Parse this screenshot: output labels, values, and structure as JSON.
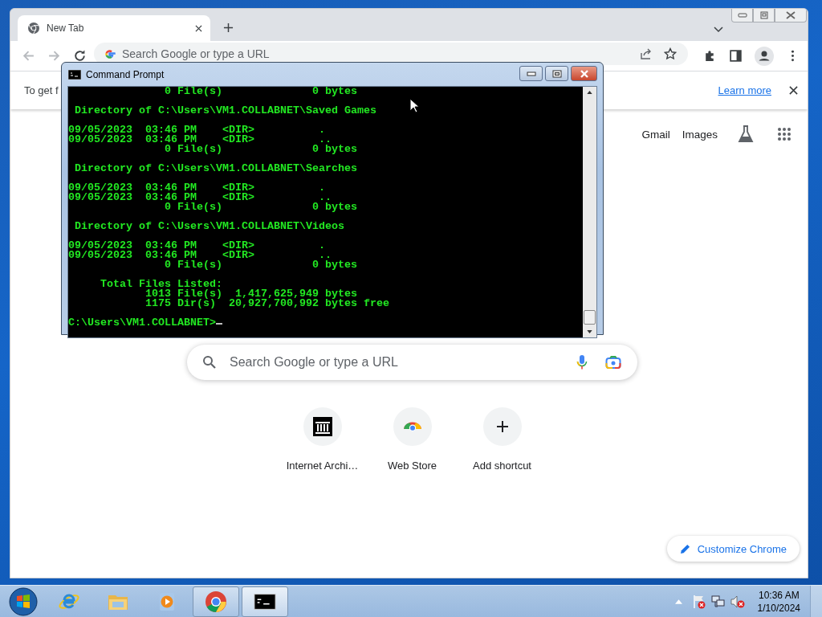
{
  "browser": {
    "tabs": [
      {
        "title": "New Tab",
        "selected": true
      }
    ],
    "omnibox": {
      "placeholder": "Search Google or type a URL"
    },
    "infobar": {
      "text": "To get f",
      "link": "Learn more"
    },
    "header_links": [
      "Gmail",
      "Images"
    ],
    "search": {
      "placeholder": "Search Google or type a URL"
    },
    "shortcuts": [
      {
        "label": "Internet Archi…",
        "kind": "archive"
      },
      {
        "label": "Web Store",
        "kind": "webstore"
      },
      {
        "label": "Add shortcut",
        "kind": "add"
      }
    ],
    "customize_button": "Customize Chrome"
  },
  "console": {
    "title": "Command Prompt",
    "blocks": [
      [
        "               0 File(s)              0 bytes"
      ],
      [
        " Directory of C:\\Users\\VM1.COLLABNET\\Saved Games"
      ],
      [
        "09/05/2023  03:46 PM    <DIR>          .",
        "09/05/2023  03:46 PM    <DIR>          ..",
        "               0 File(s)              0 bytes"
      ],
      [
        " Directory of C:\\Users\\VM1.COLLABNET\\Searches"
      ],
      [
        "09/05/2023  03:46 PM    <DIR>          .",
        "09/05/2023  03:46 PM    <DIR>          ..",
        "               0 File(s)              0 bytes"
      ],
      [
        " Directory of C:\\Users\\VM1.COLLABNET\\Videos"
      ],
      [
        "09/05/2023  03:46 PM    <DIR>          .",
        "09/05/2023  03:46 PM    <DIR>          ..",
        "               0 File(s)              0 bytes"
      ],
      [
        "     Total Files Listed:",
        "            1013 File(s)  1,417,625,949 bytes",
        "            1175 Dir(s)  20,927,700,992 bytes free"
      ],
      [
        "C:\\Users\\VM1.COLLABNET>"
      ]
    ]
  },
  "taskbar": {
    "apps": [
      {
        "kind": "ie",
        "running": false,
        "selected": false
      },
      {
        "kind": "explorer",
        "running": false,
        "selected": false
      },
      {
        "kind": "media",
        "running": false,
        "selected": false
      },
      {
        "kind": "chrome",
        "running": true,
        "selected": false
      },
      {
        "kind": "cmd",
        "running": true,
        "selected": true
      }
    ],
    "clock": {
      "time": "10:36 AM",
      "date": "1/10/2024"
    }
  }
}
